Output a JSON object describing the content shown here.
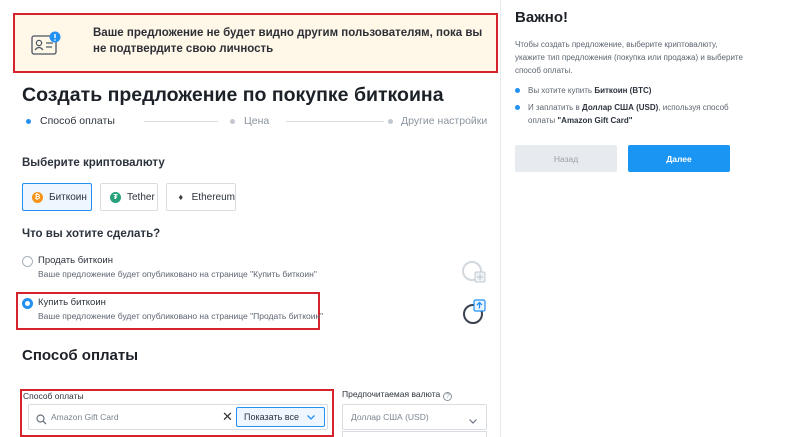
{
  "banner": {
    "icon": "id-card-alert-icon",
    "text": "Ваше предложение не будет видно другим пользователям, пока вы не подтвердите свою личность"
  },
  "page_title": "Создать предложение по покупке биткоина",
  "stepper": {
    "steps": [
      {
        "label": "Способ оплаты",
        "active": true
      },
      {
        "label": "Цена",
        "active": false
      },
      {
        "label": "Другие настройки",
        "active": false
      }
    ]
  },
  "crypto": {
    "label": "Выберите криптовалюту",
    "options": [
      {
        "label": "Биткоин",
        "icon": "bitcoin-icon",
        "color": "#f7931a",
        "selected": true
      },
      {
        "label": "Tether",
        "icon": "tether-icon",
        "color": "#26a17b",
        "selected": false
      },
      {
        "label": "Ethereum",
        "icon": "ethereum-icon",
        "color": "#3c3c3d",
        "selected": false
      }
    ]
  },
  "action": {
    "label": "Что вы хотите сделать?",
    "options": [
      {
        "title": "Продать биткоин",
        "description": "Ваше предложение будет опубликовано на странице \"Купить биткоин\"",
        "checked": false
      },
      {
        "title": "Купить биткоин",
        "description": "Ваше предложение будет опубликовано на странице \"Продать биткоин\"",
        "checked": true
      }
    ]
  },
  "payment": {
    "heading": "Способ оплаты",
    "method_label": "Способ оплаты",
    "method_value": "Amazon Gift Card",
    "show_all_label": "Показать все",
    "currency_label": "Предпочитаемая валюта",
    "currency_value": "Доллар США (USD)"
  },
  "sidebar": {
    "title": "Важно!",
    "intro": "Чтобы создать предложение, выберите криптовалюту, укажите тип предложения (покупка или продажа) и выберите способ оплаты.",
    "bullet1_prefix": "Вы хотите купить",
    "bullet1_value": "Биткоин (BTC)",
    "bullet2_prefix": "И заплатить в",
    "bullet2_currency": "Доллар США (USD)",
    "bullet2_middle": ", используя способ оплаты",
    "bullet2_method": "\"Amazon Gift Card\"",
    "back_label": "Назад",
    "next_label": "Далее"
  },
  "colors": {
    "accent": "#2391f2",
    "highlight_border": "#d6222a",
    "banner_bg": "#fff7e8"
  }
}
